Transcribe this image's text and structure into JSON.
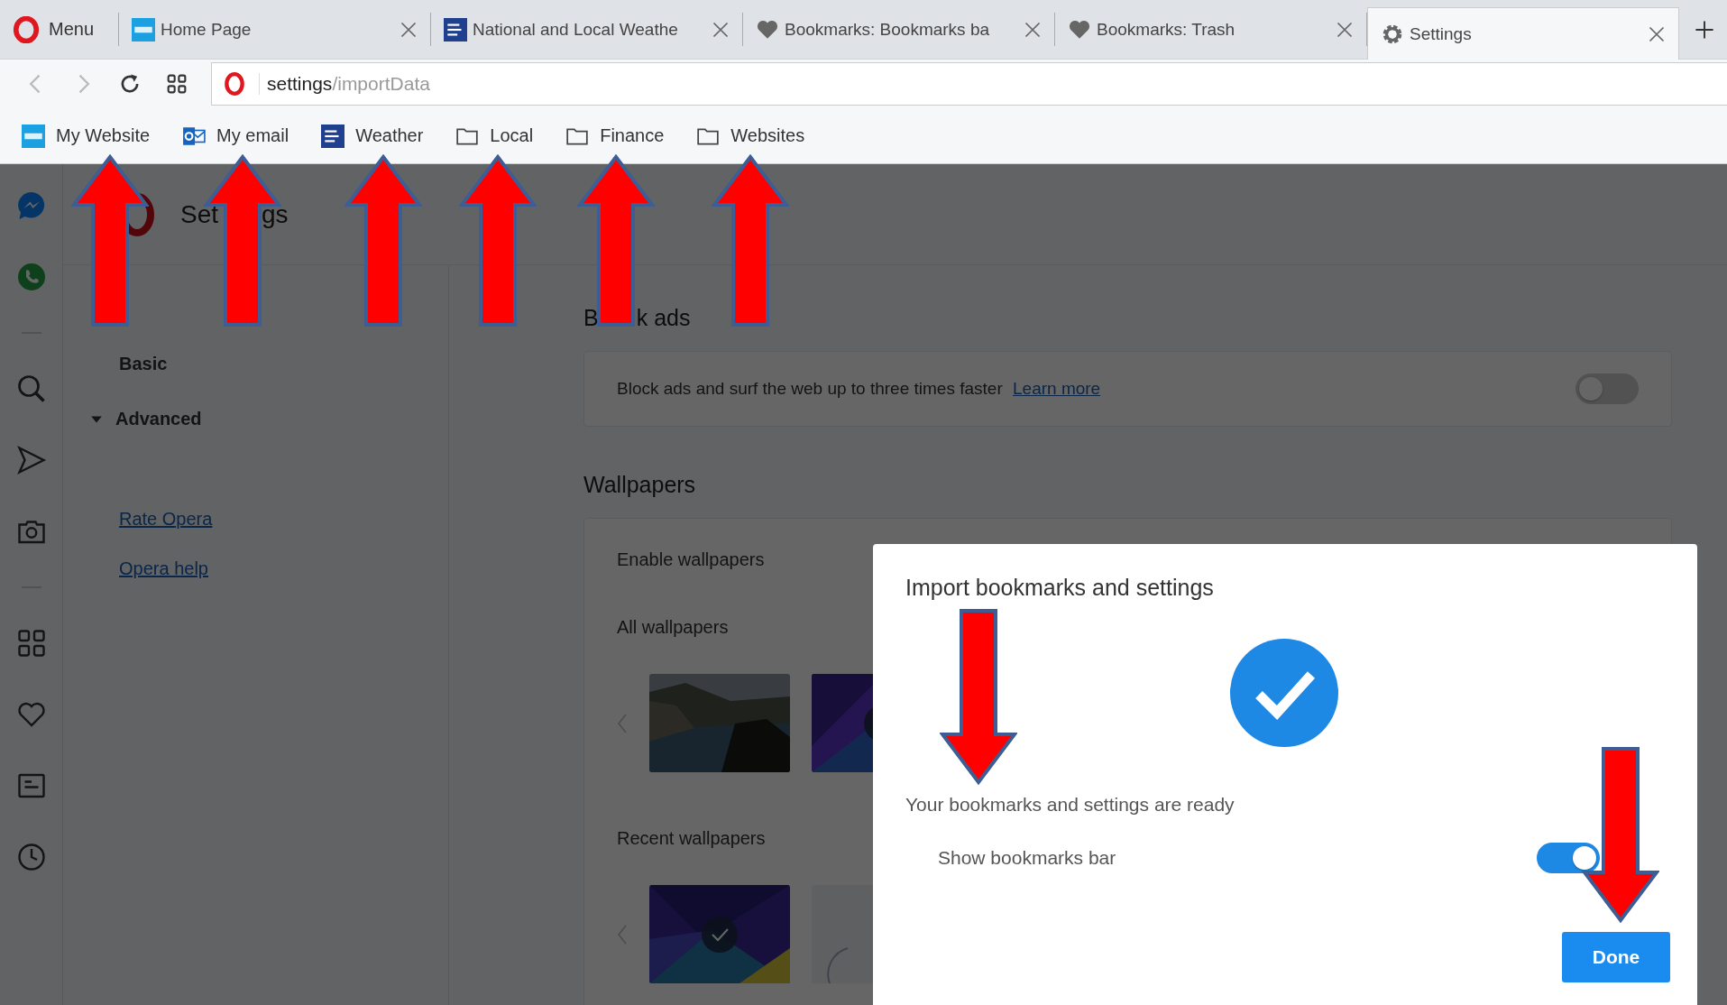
{
  "menu": {
    "label": "Menu"
  },
  "tabs": [
    {
      "label": "Home Page",
      "selected": false
    },
    {
      "label": "National and Local Weathe",
      "selected": false
    },
    {
      "label": "Bookmarks: Bookmarks ba",
      "selected": false
    },
    {
      "label": "Bookmarks: Trash",
      "selected": false
    },
    {
      "label": "Settings",
      "selected": true
    }
  ],
  "address": {
    "host": "settings",
    "path": "/importData"
  },
  "bookmarks": [
    {
      "label": "My Website",
      "kind": "link"
    },
    {
      "label": "My email",
      "kind": "link"
    },
    {
      "label": "Weather",
      "kind": "link"
    },
    {
      "label": "Local",
      "kind": "folder"
    },
    {
      "label": "Finance",
      "kind": "folder"
    },
    {
      "label": "Websites",
      "kind": "folder"
    }
  ],
  "settings": {
    "title_parts": [
      "Set",
      "gs"
    ],
    "nav": [
      {
        "label": "Basic"
      },
      {
        "label": "Advanced",
        "expanded": true
      }
    ],
    "links": [
      "Rate Opera",
      "Opera help"
    ],
    "block_ads": {
      "heading_parts": [
        "B",
        "k ads"
      ],
      "description": "Block ads and surf the web up to three times faster",
      "link": "Learn more",
      "on": false
    },
    "wallpapers": {
      "heading": "Wallpapers",
      "enable_label": "Enable wallpapers",
      "all_label": "All wallpapers",
      "recent_label": "Recent wallpapers",
      "all": [
        {
          "kind": "picture",
          "selected": false
        },
        {
          "kind": "picture",
          "selected": true
        }
      ],
      "recent": [
        {
          "kind": "picture",
          "selected": true
        },
        {
          "kind": "picture",
          "selected": false
        }
      ]
    }
  },
  "dialog": {
    "title": "Import bookmarks and settings",
    "message": "Your bookmarks and settings are ready",
    "option": {
      "label": "Show bookmarks bar",
      "on": true
    },
    "button": "Done"
  }
}
